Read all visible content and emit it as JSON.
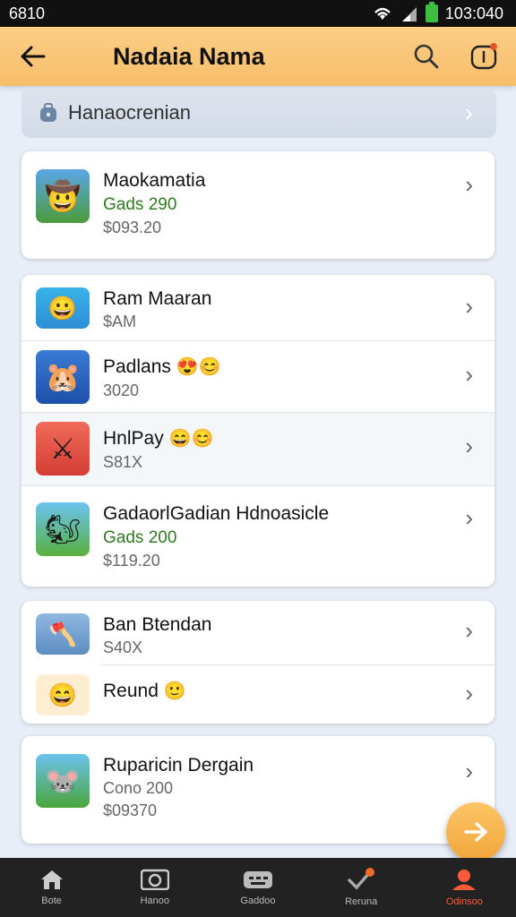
{
  "status_bar": {
    "time_left": "6810",
    "time_right": "103:040"
  },
  "header": {
    "title": "Nadaia Nama"
  },
  "search": {
    "label": "Hanaocrenian"
  },
  "items": [
    {
      "name": "Maokamatia",
      "sub_green": "Gads 290",
      "price": "$093.20"
    },
    {
      "name": "Ram Maaran",
      "price": "$AM"
    },
    {
      "name": "Padlans",
      "emoji": "😍😊",
      "price": "3020"
    },
    {
      "name": "HnlPay",
      "emoji": "😄😊",
      "price": "S81X"
    },
    {
      "name": "GadaorlGadian Hdnoasicle",
      "sub_green": "Gads 200",
      "price": "$119.20"
    },
    {
      "name": "Ban Btendan",
      "price": "S40X"
    },
    {
      "name": "Reund",
      "emoji": "🙂"
    },
    {
      "name": "Ruparicin Dergain",
      "sub_gray": "Cono 200",
      "price": "$09370"
    }
  ],
  "nav": [
    {
      "label": "Bote",
      "icon": "home-icon"
    },
    {
      "label": "Hanoo",
      "icon": "camera-icon"
    },
    {
      "label": "Gaddoo",
      "icon": "gamepad-icon"
    },
    {
      "label": "Reruna",
      "icon": "check-icon"
    },
    {
      "label": "Odinsoo",
      "icon": "profile-icon"
    }
  ],
  "colors": {
    "app_bar": "#f7bd6a",
    "accent": "#f2a53a",
    "nav_active": "#ff5a3c",
    "green_text": "#2d7a1f"
  }
}
